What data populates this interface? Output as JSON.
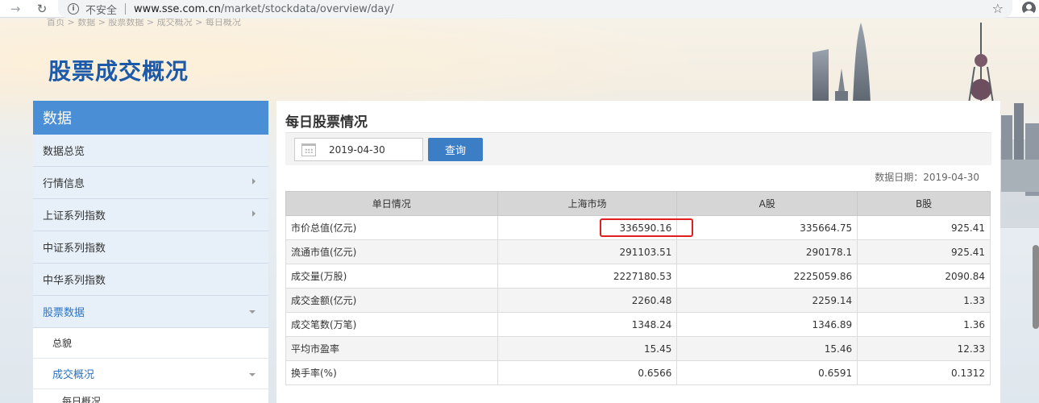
{
  "browser": {
    "insecure_label": "不安全",
    "url_host": "www.sse.com.cn",
    "url_path": "/market/stockdata/overview/day/"
  },
  "header": {
    "breadcrumb": "首页 > 数据 > 股票数据 > 成交概况 > 每日概况",
    "title": "股票成交概况"
  },
  "sidebar": {
    "title": "数据",
    "items": [
      {
        "label": "数据总览"
      },
      {
        "label": "行情信息"
      },
      {
        "label": "上证系列指数"
      },
      {
        "label": "中证系列指数"
      },
      {
        "label": "中华系列指数"
      },
      {
        "label": "股票数据"
      }
    ],
    "sub_items": [
      {
        "label": "总貌"
      },
      {
        "label": "成交概况"
      }
    ],
    "sub_sub_items": [
      {
        "label": "每日概况"
      }
    ]
  },
  "panel": {
    "title": "每日股票情况",
    "date_value": "2019-04-30",
    "query_label": "查询",
    "data_date": "数据日期：2019-04-30"
  },
  "table": {
    "headers": [
      "单日情况",
      "上海市场",
      "A股",
      "B股"
    ],
    "rows": [
      [
        "市价总值(亿元)",
        "336590.16",
        "335664.75",
        "925.41"
      ],
      [
        "流通市值(亿元)",
        "291103.51",
        "290178.1",
        "925.41"
      ],
      [
        "成交量(万股)",
        "2227180.53",
        "2225059.86",
        "2090.84"
      ],
      [
        "成交金额(亿元)",
        "2260.48",
        "2259.14",
        "1.33"
      ],
      [
        "成交笔数(万笔)",
        "1348.24",
        "1346.89",
        "1.36"
      ],
      [
        "平均市盈率",
        "15.45",
        "15.46",
        "12.33"
      ],
      [
        "换手率(%)",
        "0.6566",
        "0.6591",
        "0.1312"
      ]
    ]
  },
  "colors": {
    "brand_blue": "#1c5aa9",
    "sidebar_header": "#4a8fd6",
    "button_blue": "#3c7ec6",
    "highlight_red": "#e02020"
  }
}
